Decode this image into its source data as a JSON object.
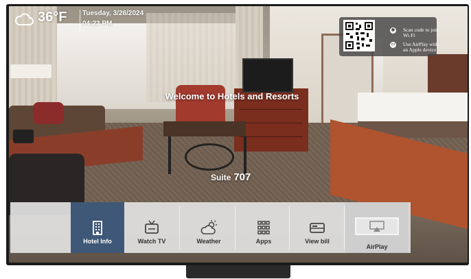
{
  "weather": {
    "icon": "cloud-icon",
    "temperature": "36°F"
  },
  "datetime": {
    "date": "Tuesday, 3/26/2024",
    "time": "04:23 PM"
  },
  "qr_panel": {
    "wifi_icon": "wifi-icon",
    "wifi_text": "Scan code to join Wi-Fi",
    "airplay_icon": "airplay-icon",
    "airplay_text": "Use AirPlay with an Apple device"
  },
  "welcome": "Welcome to Hotels and Resorts",
  "suite": {
    "label": "Suite",
    "number": "707"
  },
  "menu": {
    "items": [
      {
        "label": "Hotel Info",
        "icon": "building-icon",
        "active": true
      },
      {
        "label": "Watch TV",
        "icon": "tv-icon",
        "active": false
      },
      {
        "label": "Weather",
        "icon": "sun-cloud-icon",
        "active": false
      },
      {
        "label": "Apps",
        "icon": "apps-grid-icon",
        "active": false
      },
      {
        "label": "View bill",
        "icon": "bill-icon",
        "active": false
      },
      {
        "label": "AirPlay",
        "icon": "airplay-screen-icon",
        "active": false
      }
    ]
  },
  "colors": {
    "active_menu": "#3f5877",
    "menu_bg": "#e1e1e1"
  }
}
